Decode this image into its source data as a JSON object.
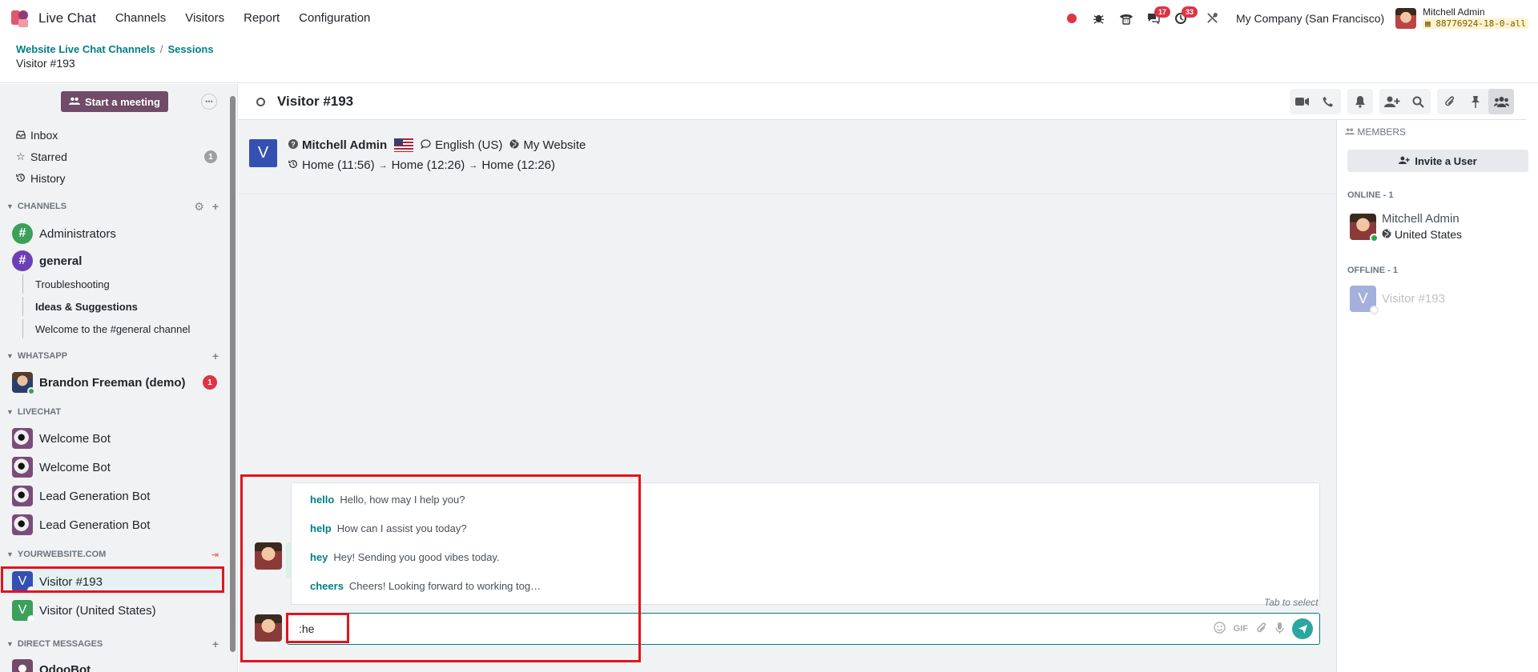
{
  "nav": {
    "app_name": "Live Chat",
    "menus": [
      "Channels",
      "Visitors",
      "Report",
      "Configuration"
    ],
    "messages_count": "17",
    "activities_count": "33",
    "company": "My Company (San Francisco)",
    "user_name": "Mitchell Admin",
    "db_name": "88776924-18-0-all"
  },
  "breadcrumb": {
    "items": [
      "Website Live Chat Channels",
      "Sessions"
    ],
    "current": "Visitor #193"
  },
  "sidebar": {
    "meeting_label": "Start a meeting",
    "inbox": "Inbox",
    "starred": "Starred",
    "starred_count": "1",
    "history": "History",
    "channels_cat": "CHANNELS",
    "channels": [
      {
        "name": "Administrators",
        "color": "#3aa05a"
      },
      {
        "name": "general",
        "color": "#6c3fb5"
      }
    ],
    "sub_threads": [
      "Troubleshooting",
      "Ideas & Suggestions",
      "Welcome to the #general channel"
    ],
    "whatsapp_cat": "WHATSAPP",
    "whatsapp_contact": "Brandon Freeman (demo)",
    "whatsapp_count": "1",
    "livechat_cat": "LIVECHAT",
    "livechat_items": [
      "Welcome Bot",
      "Welcome Bot",
      "Lead Generation Bot",
      "Lead Generation Bot"
    ],
    "website_cat": "YOURWEBSITE.COM",
    "website_items": [
      {
        "name": "Visitor #193",
        "initial": "V",
        "color": "#3451b2"
      },
      {
        "name": "Visitor (United States)",
        "initial": "V",
        "color": "#3aa05a"
      }
    ],
    "dm_cat": "DIRECT MESSAGES",
    "dm_items": [
      "OdooBot"
    ]
  },
  "thread": {
    "title": "Visitor #193",
    "avatar_initial": "V",
    "operator": "Mitchell Admin",
    "language": "English (US)",
    "website": "My Website",
    "history": [
      "Home (11:56)",
      "Home (12:26)",
      "Home (12:26)"
    ],
    "history_sep": "→"
  },
  "suggestions": {
    "items": [
      {
        "key": "hello",
        "text": "Hello, how may I help you?"
      },
      {
        "key": "help",
        "text": "How can I assist you today?"
      },
      {
        "key": "hey",
        "text": "Hey! Sending you good vibes today."
      },
      {
        "key": "cheers",
        "text": "Cheers! Looking forward to working tog…"
      }
    ],
    "hint": "Tab to select"
  },
  "composer": {
    "value": ":he",
    "gif_label": "GIF"
  },
  "members": {
    "title": "MEMBERS",
    "invite_label": "Invite a User",
    "online_label": "ONLINE - 1",
    "online_member": "Mitchell Admin",
    "online_country": "United States",
    "offline_label": "OFFLINE - 1",
    "offline_member": "Visitor #193",
    "offline_initial": "V"
  },
  "colors": {
    "accent": "#017e84",
    "brand": "#714b67",
    "highlight": "#e1141e"
  }
}
